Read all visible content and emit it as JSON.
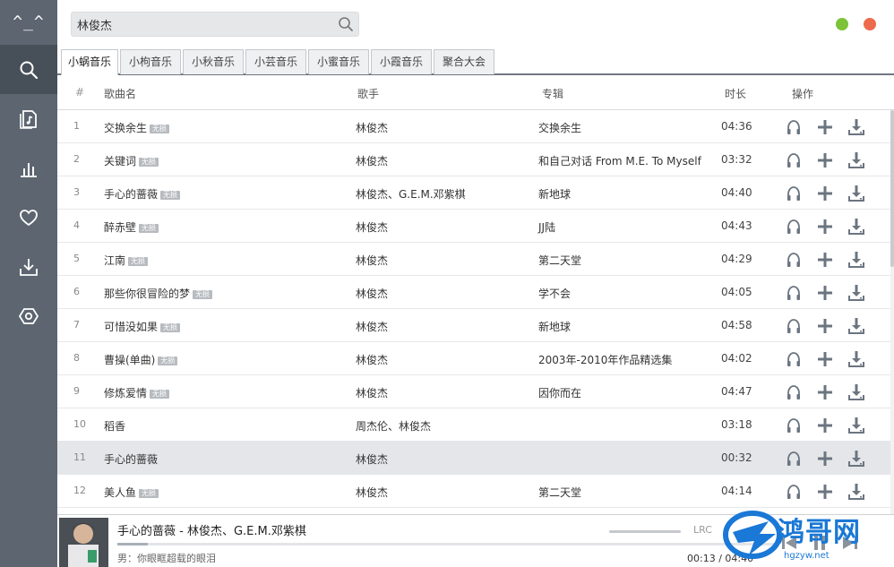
{
  "app": {
    "logo": "^_^"
  },
  "sidebar": {
    "items": [
      {
        "icon": "search-icon",
        "active": true
      },
      {
        "icon": "music-file-icon",
        "active": false
      },
      {
        "icon": "bar-chart-icon",
        "active": false
      },
      {
        "icon": "heart-icon",
        "active": false
      },
      {
        "icon": "download-icon",
        "active": false
      },
      {
        "icon": "settings-hexagon-icon",
        "active": false
      }
    ]
  },
  "search": {
    "value": "林俊杰",
    "placeholder": ""
  },
  "tabs": [
    "小蜗音乐",
    "小枸音乐",
    "小秋音乐",
    "小芸音乐",
    "小蜜音乐",
    "小霞音乐",
    "聚合大会"
  ],
  "active_tab": 0,
  "columns": {
    "num": "#",
    "name": "歌曲名",
    "artist": "歌手",
    "album": "专辑",
    "duration": "时长",
    "ops": "操作"
  },
  "badge_label": "无损",
  "songs": [
    {
      "num": "1",
      "name": "交换余生",
      "lossless": true,
      "artist": "林俊杰",
      "album": "交换余生",
      "duration": "04:36"
    },
    {
      "num": "2",
      "name": "关键词",
      "lossless": true,
      "artist": "林俊杰",
      "album": "和自己对话 From M.E. To Myself",
      "duration": "03:32"
    },
    {
      "num": "3",
      "name": "手心的蔷薇",
      "lossless": true,
      "artist": "林俊杰、G.E.M.邓紫棋",
      "album": "新地球",
      "duration": "04:40"
    },
    {
      "num": "4",
      "name": "醉赤壁",
      "lossless": true,
      "artist": "林俊杰",
      "album": "JJ陆",
      "duration": "04:43"
    },
    {
      "num": "5",
      "name": "江南",
      "lossless": true,
      "artist": "林俊杰",
      "album": "第二天堂",
      "duration": "04:29"
    },
    {
      "num": "6",
      "name": "那些你很冒险的梦",
      "lossless": true,
      "artist": "林俊杰",
      "album": "学不会",
      "duration": "04:05"
    },
    {
      "num": "7",
      "name": "可惜没如果",
      "lossless": true,
      "artist": "林俊杰",
      "album": "新地球",
      "duration": "04:58"
    },
    {
      "num": "8",
      "name": "曹操(单曲)",
      "lossless": true,
      "artist": "林俊杰",
      "album": "2003年-2010年作品精选集",
      "duration": "04:02"
    },
    {
      "num": "9",
      "name": "修炼爱情",
      "lossless": true,
      "artist": "林俊杰",
      "album": "因你而在",
      "duration": "04:47"
    },
    {
      "num": "10",
      "name": "稻香",
      "lossless": false,
      "artist": "周杰伦、林俊杰",
      "album": "",
      "duration": "03:18"
    },
    {
      "num": "11",
      "name": "手心的蔷薇",
      "lossless": false,
      "artist": "林俊杰",
      "album": "",
      "duration": "00:32",
      "active": true
    },
    {
      "num": "12",
      "name": "美人鱼",
      "lossless": true,
      "artist": "林俊杰",
      "album": "第二天堂",
      "duration": "04:14"
    }
  ],
  "player": {
    "title": "手心的蔷薇 - 林俊杰、G.E.M.邓紫棋",
    "lyric": "男：你眼眶超载的眼泪",
    "current_time": "00:13",
    "separator": "/",
    "total_time": "04:40",
    "lrc_label": "LRC",
    "progress": 0.046
  },
  "watermark": {
    "text": "鸿哥网",
    "sub": "hgzyw.net"
  },
  "colors": {
    "sidebar": "#5c6570",
    "sidebar_active": "#474f59",
    "window_min": "#7cc33a",
    "window_close": "#ee6a4d",
    "watermark": "#1a78d6"
  }
}
